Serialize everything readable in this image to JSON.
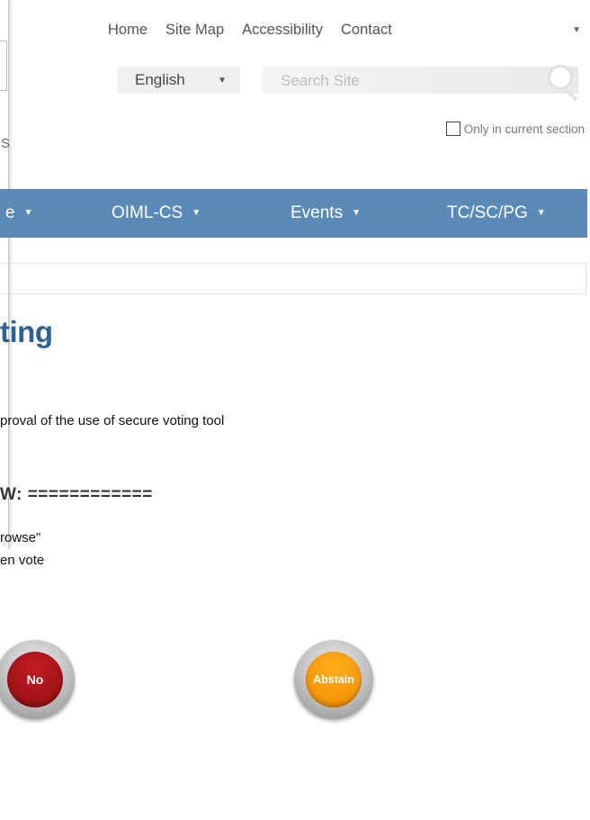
{
  "top_nav": {
    "items": [
      "Home",
      "Site Map",
      "Accessibility",
      "Contact"
    ]
  },
  "language": {
    "selected": "English"
  },
  "search": {
    "placeholder": "Search Site"
  },
  "section_filter": {
    "label": "Only in current section",
    "checked": false
  },
  "side_panel": {
    "fragment": "S"
  },
  "menu": {
    "items": [
      {
        "label": "e"
      },
      {
        "label": "OIML-CS"
      },
      {
        "label": "Events"
      },
      {
        "label": "TC/SC/PG"
      }
    ]
  },
  "page": {
    "title_fragment": "ting",
    "line1": "proval of the use of secure voting tool",
    "howto": "W:  ============",
    "line2": "rowse\"",
    "line3": "en vote"
  },
  "vote_buttons": {
    "no": "No",
    "abstain": "Abstain"
  },
  "colors": {
    "menu_bar": "#5a8bb8",
    "heading": "#2d6093",
    "no_button": "#b3161b",
    "abstain_button": "#f7990d"
  }
}
